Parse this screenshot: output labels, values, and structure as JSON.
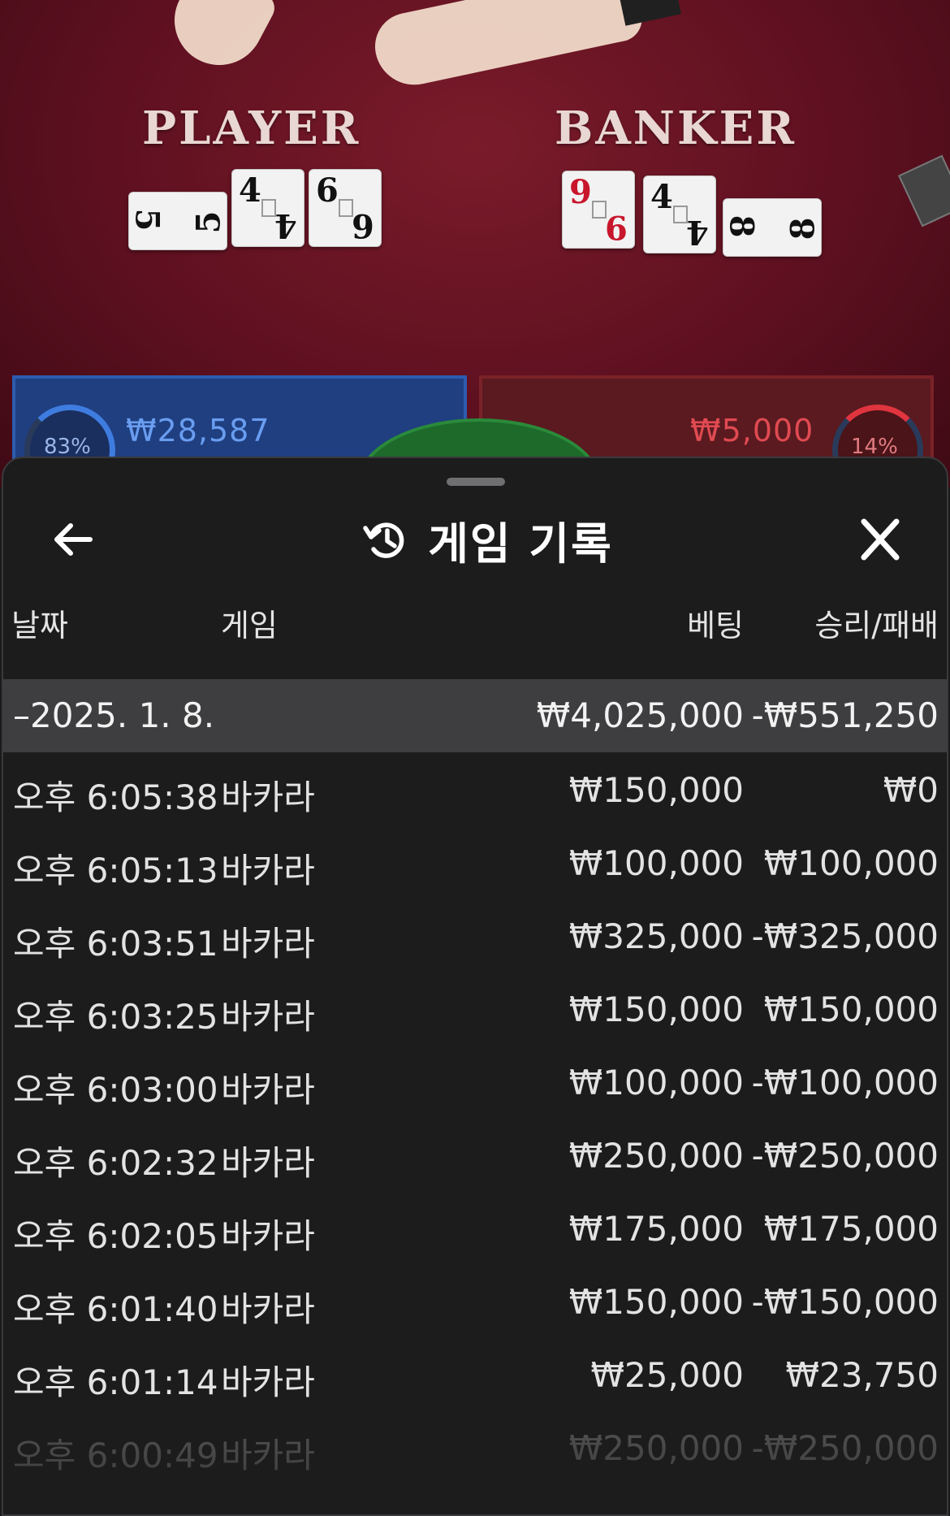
{
  "table": {
    "player_label": "PLAYER",
    "banker_label": "BANKER",
    "player_cards": [
      {
        "rank": "5",
        "suit": "♠",
        "color": "black",
        "orientation": "side"
      },
      {
        "rank": "4",
        "suit": "♠",
        "color": "black",
        "orientation": "upright"
      },
      {
        "rank": "6",
        "suit": "♠",
        "color": "black",
        "orientation": "upright"
      }
    ],
    "banker_cards": [
      {
        "rank": "9",
        "suit": "♥",
        "color": "red",
        "orientation": "upright"
      },
      {
        "rank": "4",
        "suit": "♣",
        "color": "black",
        "orientation": "upright"
      },
      {
        "rank": "8",
        "suit": "♣",
        "color": "black",
        "orientation": "side"
      }
    ],
    "player_percent": "83%",
    "player_bet": "₩28,587",
    "banker_bet": "₩5,000",
    "banker_percent": "14%"
  },
  "sheet": {
    "back_icon": "arrow-left-icon",
    "history_icon": "history-icon",
    "title": "게임 기록",
    "close_icon": "close-icon"
  },
  "columns": {
    "date": "날짜",
    "game": "게임",
    "bet": "베팅",
    "result": "승리/패배"
  },
  "date_group": {
    "label": "–2025. 1. 8.",
    "total_bet": "₩4,025,000",
    "total_result": "-₩551,250"
  },
  "rows": [
    {
      "time": "오후 6:05:38",
      "game": "바카라",
      "bet": "₩150,000",
      "result": "₩0"
    },
    {
      "time": "오후 6:05:13",
      "game": "바카라",
      "bet": "₩100,000",
      "result": "₩100,000"
    },
    {
      "time": "오후 6:03:51",
      "game": "바카라",
      "bet": "₩325,000",
      "result": "-₩325,000"
    },
    {
      "time": "오후 6:03:25",
      "game": "바카라",
      "bet": "₩150,000",
      "result": "₩150,000"
    },
    {
      "time": "오후 6:03:00",
      "game": "바카라",
      "bet": "₩100,000",
      "result": "-₩100,000"
    },
    {
      "time": "오후 6:02:32",
      "game": "바카라",
      "bet": "₩250,000",
      "result": "-₩250,000"
    },
    {
      "time": "오후 6:02:05",
      "game": "바카라",
      "bet": "₩175,000",
      "result": "₩175,000"
    },
    {
      "time": "오후 6:01:40",
      "game": "바카라",
      "bet": "₩150,000",
      "result": "-₩150,000"
    },
    {
      "time": "오후 6:01:14",
      "game": "바카라",
      "bet": "₩25,000",
      "result": "₩23,750"
    },
    {
      "time": "오후 6:00:49",
      "game": "바카라",
      "bet": "₩250,000",
      "result": "-₩250,000"
    }
  ]
}
